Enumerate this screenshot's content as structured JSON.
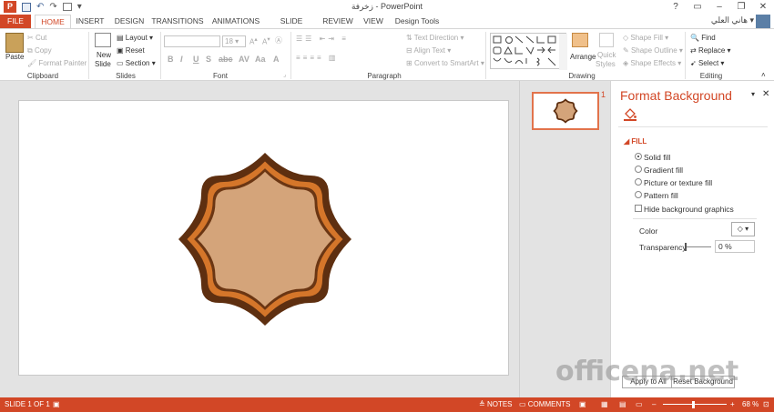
{
  "window": {
    "title": "زخرفة - PowerPoint",
    "help": "?",
    "controls": [
      "▭",
      "–",
      "❐",
      "✕"
    ]
  },
  "qat": {
    "undo": "↶",
    "redo": "↷",
    "more": "▾",
    "logo": "P"
  },
  "tabs": [
    "FILE",
    "HOME",
    "INSERT",
    "DESIGN",
    "TRANSITIONS",
    "ANIMATIONS",
    "SLIDE SHOW",
    "REVIEW",
    "VIEW",
    "Design Tools"
  ],
  "user": {
    "name": "هاني العلي",
    "chevron": "▾"
  },
  "ribbon": {
    "clipboard": {
      "label": "Clipboard",
      "paste": "Paste",
      "cut": "Cut",
      "copy": "Copy",
      "format_painter": "Format Painter"
    },
    "slides": {
      "label": "Slides",
      "new_slide_1": "New",
      "new_slide_2": "Slide",
      "layout": "Layout",
      "reset": "Reset",
      "section": "Section"
    },
    "font": {
      "label": "Font",
      "size": "18"
    },
    "paragraph": {
      "label": "Paragraph",
      "text_direction": "Text Direction",
      "align_text": "Align Text",
      "convert_smartart": "Convert to SmartArt"
    },
    "drawing": {
      "label": "Drawing",
      "arrange": "Arrange",
      "quick_styles_1": "Quick",
      "quick_styles_2": "Styles",
      "shape_fill": "Shape Fill",
      "shape_outline": "Shape Outline",
      "shape_effects": "Shape Effects"
    },
    "editing": {
      "label": "Editing",
      "find": "Find",
      "replace": "Replace",
      "select": "Select"
    }
  },
  "thumbnail": {
    "number": "1"
  },
  "pane": {
    "title": "Format Background",
    "section": "FILL",
    "options": [
      "Solid fill",
      "Gradient fill",
      "Picture or texture fill",
      "Pattern fill"
    ],
    "selected": "Solid fill",
    "hide_graphics": "Hide background graphics",
    "color_label": "Color",
    "transparency_label": "Transparency",
    "transparency_value": "0 %",
    "apply_all": "Apply to All",
    "reset_background": "Reset Background"
  },
  "status": {
    "slide": "SLIDE 1 OF 1",
    "notes": "NOTES",
    "comments": "COMMENTS",
    "zoom": "68 %"
  },
  "watermark": "officena.net",
  "colors": {
    "accent": "#d24726",
    "shape_outer": "#5e2f10",
    "shape_mid": "#d5762a",
    "shape_inner": "#d4a47a"
  }
}
